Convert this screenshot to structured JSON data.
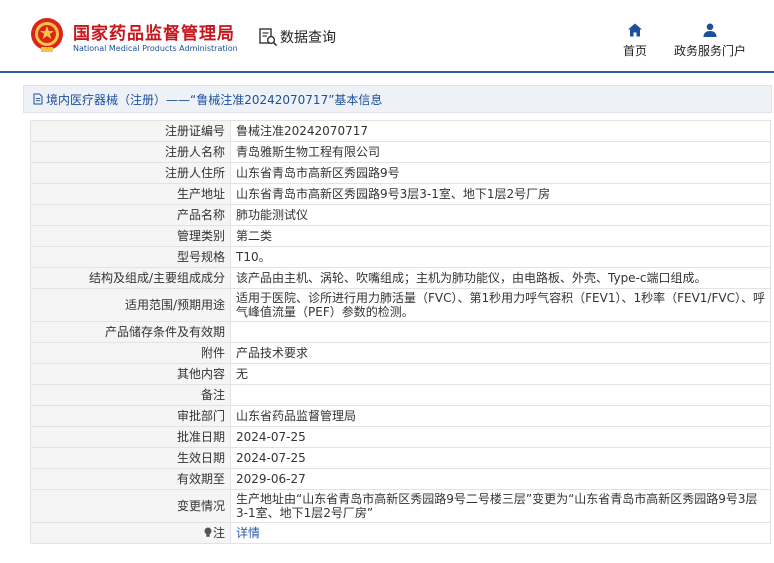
{
  "header": {
    "brand_cn": "国家药品监督管理局",
    "brand_en": "National Medical Products Administration",
    "query_label": "数据查询",
    "nav": [
      {
        "label": "首页",
        "icon": "home-icon"
      },
      {
        "label": "政务服务门户",
        "icon": "user-icon"
      }
    ]
  },
  "breadcrumb": {
    "text": "境内医疗器械（注册）——“鲁械注准20242070717”基本信息"
  },
  "colors": {
    "brand_red": "#c8161d",
    "brand_blue": "#1d4f9c",
    "header_line": "#2a5caa",
    "label_bg": "#f5f5f5",
    "crumb_bg": "#eef2f7"
  },
  "rows": [
    {
      "label": "注册证编号",
      "value": "鲁械注准20242070717"
    },
    {
      "label": "注册人名称",
      "value": "青岛雅斯生物工程有限公司"
    },
    {
      "label": "注册人住所",
      "value": "山东省青岛市高新区秀园路9号"
    },
    {
      "label": "生产地址",
      "value": "山东省青岛市高新区秀园路9号3层3-1室、地下1层2号厂房"
    },
    {
      "label": "产品名称",
      "value": "肺功能测试仪"
    },
    {
      "label": "管理类别",
      "value": "第二类"
    },
    {
      "label": "型号规格",
      "value": "T10。"
    },
    {
      "label": "结构及组成/主要组成成分",
      "value": "该产品由主机、涡轮、吹嘴组成；主机为肺功能仪，由电路板、外壳、Type-c端口组成。"
    },
    {
      "label": "适用范围/预期用途",
      "value": "适用于医院、诊所进行用力肺活量（FVC）、第1秒用力呼气容积（FEV1）、1秒率（FEV1/FVC）、呼气峰值流量（PEF）参数的检测。"
    },
    {
      "label": "产品储存条件及有效期",
      "value": ""
    },
    {
      "label": "附件",
      "value": "产品技术要求"
    },
    {
      "label": "其他内容",
      "value": "无"
    },
    {
      "label": "备注",
      "value": ""
    },
    {
      "label": "审批部门",
      "value": "山东省药品监督管理局"
    },
    {
      "label": "批准日期",
      "value": "2024-07-25"
    },
    {
      "label": "生效日期",
      "value": "2024-07-25"
    },
    {
      "label": "有效期至",
      "value": "2029-06-27"
    },
    {
      "label": "变更情况",
      "value": "生产地址由“山东省青岛市高新区秀园路9号二号楼三层”变更为“山东省青岛市高新区秀园路9号3层3-1室、地下1层2号厂房”"
    },
    {
      "label": "注",
      "value": "详情",
      "icon": "lightbulb-icon"
    }
  ]
}
